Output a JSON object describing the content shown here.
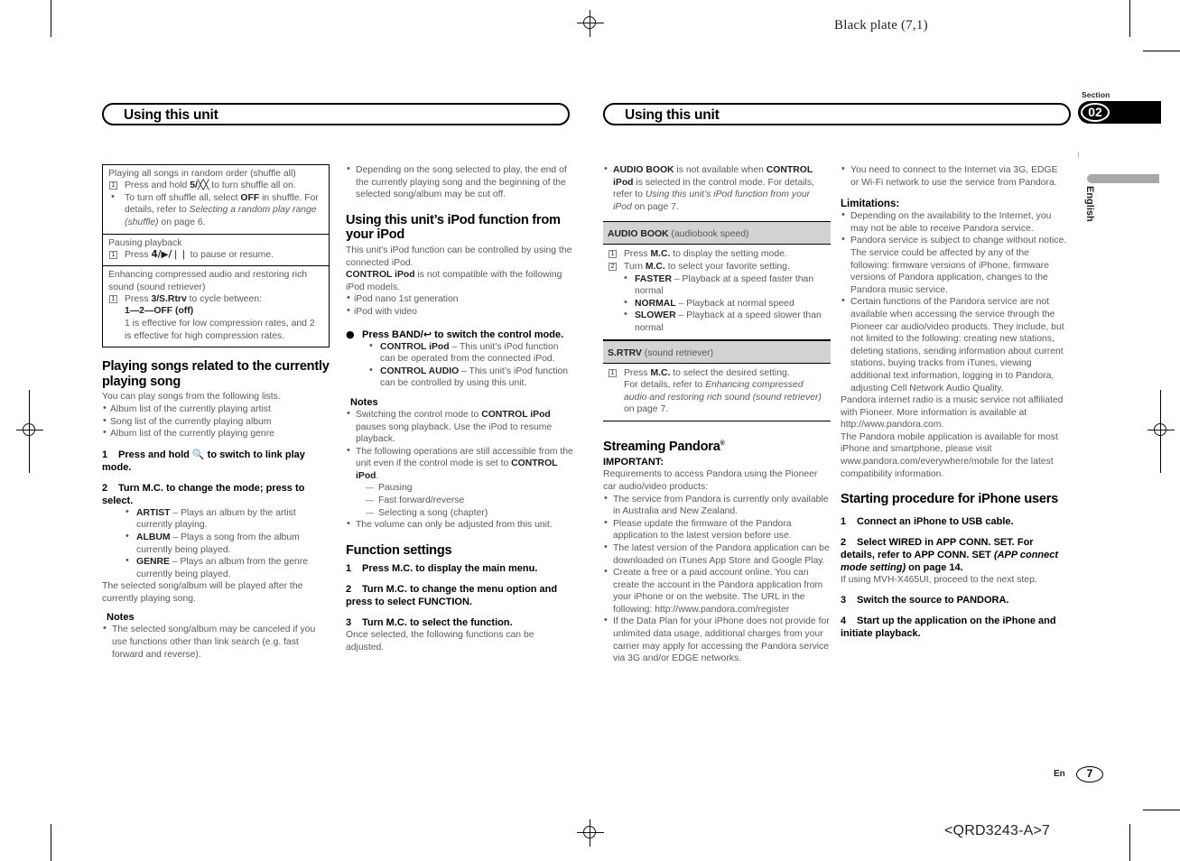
{
  "page": {
    "black_plate": "Black plate (7,1)",
    "section_label": "Section",
    "section_number": "02",
    "language_tab": "English",
    "footer_en": "En",
    "footer_page": "7",
    "footer_code": "<QRD3243-A>7"
  },
  "running_heads": {
    "left": "Using this unit",
    "right": "Using this unit"
  },
  "col1": {
    "opbox": [
      {
        "title": "Playing all songs in random order (shuffle all)",
        "steps": [
          {
            "num": "1",
            "pre": "Press and hold ",
            "key": "5/",
            "icon": "shuffle-icon",
            "post": " to turn shuffle all on."
          }
        ],
        "bullets": [
          {
            "text_a": "To turn off shuffle all, select ",
            "bold": "OFF",
            "text_b": " in shuffle. For details, refer to ",
            "italic": "Selecting a random play range (shuffle)",
            "text_c": " on page 6."
          }
        ]
      },
      {
        "title": "Pausing playback",
        "steps": [
          {
            "num": "1",
            "pre": "Press ",
            "key": "4/▶/❘❘",
            "post": " to pause or resume."
          }
        ],
        "bullets": []
      },
      {
        "title": "Enhancing compressed audio and restoring rich sound (sound retriever)",
        "steps": [
          {
            "num": "1",
            "pre": "Press ",
            "key": "3/S.Rtrv",
            "post": " to cycle between:"
          }
        ],
        "extra_lines": [
          "1—2—OFF (off)",
          "1 is effective for low compression rates, and 2 is effective for high compression rates."
        ],
        "bullets": []
      }
    ],
    "heading": "Playing songs related to the currently playing song",
    "intro": "You can play songs from the following lists.",
    "list": [
      "Album list of the currently playing artist",
      "Song list of the currently playing album",
      "Album list of the currently playing genre"
    ],
    "step1": {
      "n": "1",
      "text_a": "Press and hold ",
      "icon": "magnifier-icon",
      "text_b": " to switch to link play mode."
    },
    "step2": {
      "n": "2",
      "text": "Turn M.C. to change the mode; press to select."
    },
    "modes": [
      {
        "name": "ARTIST",
        "desc": " – Plays an album by the artist currently playing."
      },
      {
        "name": "ALBUM",
        "desc": " – Plays a song from the album currently being played."
      },
      {
        "name": "GENRE",
        "desc": " – Plays an album from the genre currently being played."
      }
    ],
    "after_modes": "The selected song/album will be played after the currently playing song.",
    "notes_title": "Notes",
    "notes": [
      "The selected song/album may be canceled if you use functions other than link search (e.g. fast forward and reverse)."
    ]
  },
  "col2": {
    "top_bullets": [
      "Depending on the song selected to play, the end of the currently playing song and the beginning of the selected song/album may be cut off."
    ],
    "heading": "Using this unit’s iPod function from your iPod",
    "para1": "This unit's iPod function can be controlled by using the connected iPod.",
    "para2_bold": "CONTROL iPod",
    "para2_rest": " is not compatible with the following iPod models.",
    "models": [
      "iPod nano 1st generation",
      "iPod with video"
    ],
    "action": {
      "pre": "Press BAND/",
      "icon": "back-icon",
      "post": " to switch the control mode."
    },
    "control_modes": [
      {
        "name": "CONTROL iPod",
        "desc": " – This unit’s iPod function can be operated from the connected iPod."
      },
      {
        "name": "CONTROL AUDIO",
        "desc": " – This unit’s iPod function can be controlled by using this unit."
      }
    ],
    "notes_title": "Notes",
    "note1_a": "Switching the control mode to ",
    "note1_b": "CONTROL iPod",
    "note1_c": " pauses song playback. Use the iPod to resume playback.",
    "note2_a": "The following operations are still accessible from the unit even if the control mode is set to ",
    "note2_b": "CONTROL iPod",
    "note2_c": ".",
    "note2_sub": [
      "Pausing",
      "Fast forward/reverse",
      "Selecting a song (chapter)"
    ],
    "note3": "The volume can only be adjusted from this unit.",
    "fn_heading": "Function settings",
    "fn_steps": [
      {
        "n": "1",
        "text": "Press M.C. to display the main menu."
      },
      {
        "n": "2",
        "text": "Turn M.C. to change the menu option and press to select FUNCTION."
      },
      {
        "n": "3",
        "text": "Turn M.C. to select the function."
      }
    ],
    "fn_after": "Once selected, the following functions can be adjusted."
  },
  "col3": {
    "top_bullet": {
      "b1": "AUDIO BOOK",
      "t1": " is not available when ",
      "b2": "CONTROL iPod",
      "t2": " is selected in the control mode. For details, refer to ",
      "i1": "Using this unit’s iPod function from your iPod",
      "t3": " on page 7."
    },
    "tables": [
      {
        "name": "AUDIO BOOK",
        "subtitle": " (audiobook speed)",
        "steps": [
          {
            "num": "1",
            "pre": "Press ",
            "key": "M.C.",
            "post": " to display the setting mode."
          },
          {
            "num": "2",
            "pre": "Turn ",
            "key": "M.C.",
            "post": " to select your favorite setting."
          }
        ],
        "options": [
          {
            "name": "FASTER",
            "desc": " – Playback at a speed faster than normal"
          },
          {
            "name": "NORMAL",
            "desc": " – Playback at normal speed"
          },
          {
            "name": "SLOWER",
            "desc": " – Playback at a speed slower than normal"
          }
        ]
      },
      {
        "name": "S.RTRV",
        "subtitle": " (sound retriever)",
        "steps": [
          {
            "num": "1",
            "pre": "Press ",
            "key": "M.C.",
            "post": " to select the desired setting."
          }
        ],
        "trailing_a": "For details, refer to ",
        "trailing_i": "Enhancing compressed audio and restoring rich sound (sound retriever)",
        "trailing_b": " on page 7.",
        "options": []
      }
    ],
    "pandora_heading": "Streaming Pandora",
    "pandora_sup": "®",
    "important": "IMPORTANT:",
    "important_intro": "Requirements to access Pandora using the Pioneer car audio/video products:",
    "requirements": [
      "The service from Pandora is currently only available in Australia and New Zealand.",
      "Please update the firmware of the Pandora application to the latest version before use.",
      "The latest version of the Pandora application can be downloaded on iTunes App Store and Google Play.",
      "Create a free or a paid account online. You can create the account in the Pandora application from your iPhone or on the website. The URL in the following: http://www.pandora.com/register",
      "If the Data Plan for your iPhone does not provide for unlimited data usage, additional charges from your carrier may apply for accessing the Pandora service via 3G and/or EDGE networks."
    ]
  },
  "col4": {
    "top_bullets": [
      "You need to connect to the Internet via 3G, EDGE or Wi-Fi network to use the service from Pandora."
    ],
    "limitations_title": "Limitations:",
    "limitations": [
      "Depending on the availability to the Internet, you may not be able to receive Pandora service.",
      "Pandora service is subject to change without notice. The service could be affected by any of the following: firmware versions of iPhone, firmware versions of Pandora application, changes to the Pandora music service.",
      "Certain functions of the Pandora service are not available when accessing the service through the Pioneer car audio/video products. They include, but not limited to the following: creating new stations, deleting stations, sending information about current stations, buying tracks from iTunes, viewing additional text information, logging in to Pandora, adjusting Cell Network Audio Quality."
    ],
    "para1": "Pandora internet radio is a music service not affiliated with Pioneer. More information is available at http://www.pandora.com.",
    "para2": "The Pandora mobile application is available for most iPhone and smartphone, please visit www.pandora.com/everywhere/mobile for the latest compatibility information.",
    "start_heading": "Starting procedure for iPhone users",
    "steps": [
      {
        "n": "1",
        "text": "Connect an iPhone to USB cable."
      },
      {
        "n": "2",
        "text_a": "Select WIRED in APP CONN. SET. For details, refer to APP CONN. SET ",
        "italic": "(APP connect mode setting)",
        "text_b": " on page 14.",
        "after": "If using MVH-X465UI, proceed to the next step."
      },
      {
        "n": "3",
        "text": "Switch the source to PANDORA."
      },
      {
        "n": "4",
        "text": "Start up the application on the iPhone and initiate playback."
      }
    ]
  }
}
